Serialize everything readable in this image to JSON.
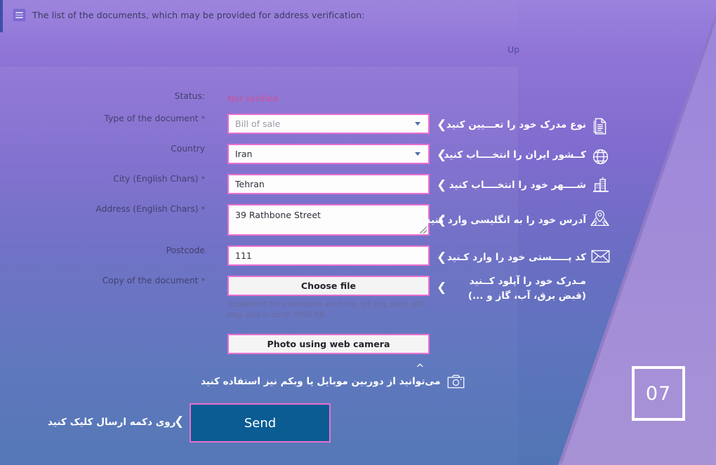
{
  "header": {
    "icon": "list-icon",
    "text": "The list of the documents, which may be provided for address verification:"
  },
  "up_link": {
    "label": "Up"
  },
  "form": {
    "status": {
      "label": "Status:",
      "value": "Not verified"
    },
    "fields": [
      {
        "label": "Type of the document",
        "required": "*",
        "value": "Bill of sale",
        "type": "select",
        "is_placeholder": true
      },
      {
        "label": "Country",
        "required": "",
        "value": "Iran",
        "type": "select",
        "is_placeholder": false
      },
      {
        "label": "City (English Chars)",
        "required": "*",
        "value": "Tehran",
        "type": "text",
        "is_placeholder": false
      },
      {
        "label": "Address (English Chars)",
        "required": "*",
        "value": "39 Rathbone Street",
        "type": "textarea",
        "is_placeholder": false
      },
      {
        "label": "Postcode",
        "required": "",
        "value": "111",
        "type": "text",
        "is_placeholder": false
      },
      {
        "label": "Copy of the document",
        "required": "*",
        "value": "Choose file",
        "type": "file-button",
        "is_placeholder": false
      }
    ],
    "file_hint": "Supported file extensions are bmp, gif, jpg, jpeg, pdf, png. size is up to 4096 KB.",
    "webcam_button": "Photo using web camera",
    "send_button": "Send"
  },
  "annotations": [
    {
      "icon": "document-icon",
      "text": "نوع مدرک خود را تعـــیین کنید"
    },
    {
      "icon": "globe-icon",
      "text": "کــشور ایران را انتخــــاب کنید"
    },
    {
      "icon": "city-icon",
      "text": "شــــهر خود را انتخــــاب کنید"
    },
    {
      "icon": "map-pin-icon",
      "text": "آدرس خود را به انگلیسی وارد کنید"
    },
    {
      "icon": "envelope-icon",
      "text": "کد پـــــستی خود را وارد کـنید"
    },
    {
      "icon": "none",
      "text": "مـدرک خود را آپلود کــنید",
      "text2": "(قبض برق، آب، گاز و ...)"
    }
  ],
  "camera_note": {
    "icon": "camera-icon",
    "text": "می‌توانید از دوربین موبایل یا وبکم نیز استفاده کنید"
  },
  "send_note": {
    "text": "روی دکمه ارسال کلیک کنید"
  },
  "step_badge": {
    "number": "07"
  },
  "colors": {
    "field_border": "#e86fd0",
    "send_bg": "#0a5c93",
    "status": "#d14f9a",
    "annotation_text": "#ffffff",
    "bg_top": "#9b82dd",
    "bg_bottom": "#5278b6",
    "bg_right": "#a892d6"
  }
}
